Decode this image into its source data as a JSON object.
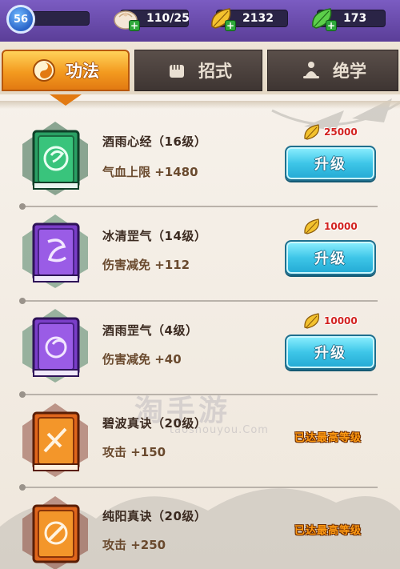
{
  "player": {
    "level": "56"
  },
  "resources": {
    "stamina": {
      "value": "110/25",
      "icon": "bun-icon"
    },
    "gold_leaf": {
      "value": "2132",
      "icon": "gold-leaf-icon"
    },
    "jade_leaf": {
      "value": "173",
      "icon": "jade-leaf-icon"
    }
  },
  "tabs": [
    {
      "label": "功法",
      "icon": "swirl-icon",
      "active": true
    },
    {
      "label": "招式",
      "icon": "fist-icon",
      "active": false
    },
    {
      "label": "绝学",
      "icon": "meditation-icon",
      "active": false
    }
  ],
  "skills": [
    {
      "name": "酒雨心经（16级）",
      "effect": "气血上限 +1480",
      "cost": "25000",
      "action": "升级",
      "book_color": "green"
    },
    {
      "name": "冰清罡气（14级）",
      "effect": "伤害减免 +112",
      "cost": "10000",
      "action": "升级",
      "book_color": "purple"
    },
    {
      "name": "酒雨罡气（4级）",
      "effect": "伤害减免 +40",
      "cost": "10000",
      "action": "升级",
      "book_color": "purple"
    },
    {
      "name": "碧波真诀（20级）",
      "effect": "攻击 +150",
      "status": "已达最高等级",
      "book_color": "orange"
    },
    {
      "name": "纯阳真诀（20级）",
      "effect": "攻击 +250",
      "status": "已达最高等级",
      "book_color": "orange"
    }
  ],
  "watermark": {
    "main": "淘手游",
    "sub": "taoshouyou.Com"
  },
  "colors": {
    "upgrade_button": "#3ec6e8",
    "active_tab": "#f39a1f",
    "cost_text": "#d2211e",
    "max_level_text": "#ff9a12"
  }
}
